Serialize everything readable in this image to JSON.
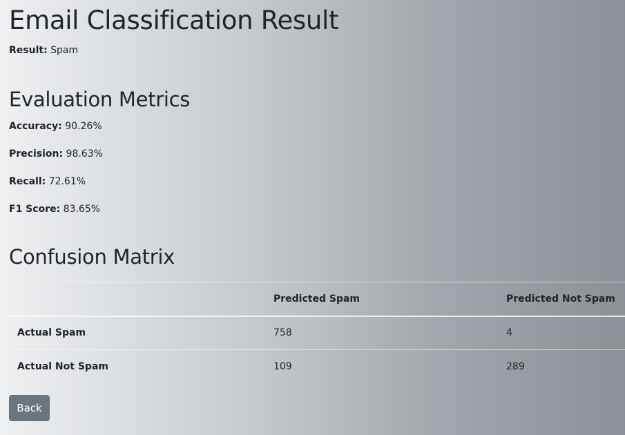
{
  "page": {
    "title": "Email Classification Result"
  },
  "result": {
    "label": "Result:",
    "value": "Spam"
  },
  "metrics": {
    "heading": "Evaluation Metrics",
    "items": [
      {
        "label": "Accuracy:",
        "value": "90.26%"
      },
      {
        "label": "Precision:",
        "value": "98.63%"
      },
      {
        "label": "Recall:",
        "value": "72.61%"
      },
      {
        "label": "F1 Score:",
        "value": "83.65%"
      }
    ]
  },
  "confusion": {
    "heading": "Confusion Matrix",
    "columns": [
      "",
      "Predicted Spam",
      "Predicted Not Spam"
    ],
    "rows": [
      {
        "label": "Actual Spam",
        "values": [
          "758",
          "4"
        ]
      },
      {
        "label": "Actual Not Spam",
        "values": [
          "109",
          "289"
        ]
      }
    ]
  },
  "actions": {
    "back_label": "Back"
  },
  "colors": {
    "button_bg": "#6c757d",
    "text": "#212529"
  }
}
